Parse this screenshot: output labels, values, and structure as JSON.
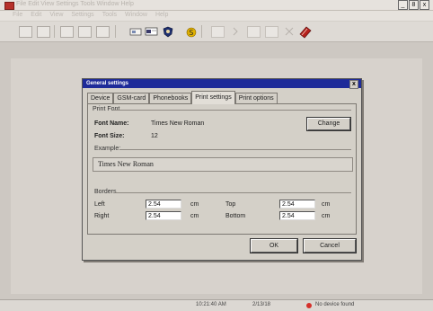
{
  "app": {
    "title": "File Edit View Settings Tools Window Help"
  },
  "window_controls": [
    "_",
    "8",
    "x"
  ],
  "menu": [
    "File",
    "Edit",
    "View",
    "Settings",
    "Tools",
    "Window",
    "Help"
  ],
  "toolbar": {
    "icons": [
      "grid-icon",
      "grid2-icon",
      "cut-icon",
      "copy-icon",
      "paste-icon",
      "phone-icon",
      "card-icon",
      "shield-icon",
      "coin-icon",
      "back-icon",
      "forward-icon",
      "undo-icon",
      "redo-icon",
      "delete-icon",
      "book-icon"
    ]
  },
  "dialog": {
    "title": "General settings",
    "close": "x",
    "tabs": [
      "Device",
      "GSM-card",
      "Phonebooks",
      "Print settings",
      "Print options"
    ],
    "active_tab": "Print settings",
    "print_font": {
      "section": "Print Font",
      "font_name_label": "Font Name:",
      "font_name_value": "Times New Roman",
      "font_size_label": "Font Size:",
      "font_size_value": "12",
      "change_button": "Change",
      "example_label": "Example:",
      "example_text": "Times New Roman"
    },
    "borders": {
      "section": "Borders",
      "left_label": "Left",
      "left_value": "2.54",
      "right_label": "Right",
      "right_value": "2.54",
      "top_label": "Top",
      "top_value": "2.54",
      "bottom_label": "Bottom",
      "bottom_value": "2.54",
      "unit": "cm"
    },
    "ok_button": "OK",
    "cancel_button": "Cancel"
  },
  "status": {
    "time": "10:21:40 AM",
    "date": "2/13/18",
    "device": "No device found"
  }
}
